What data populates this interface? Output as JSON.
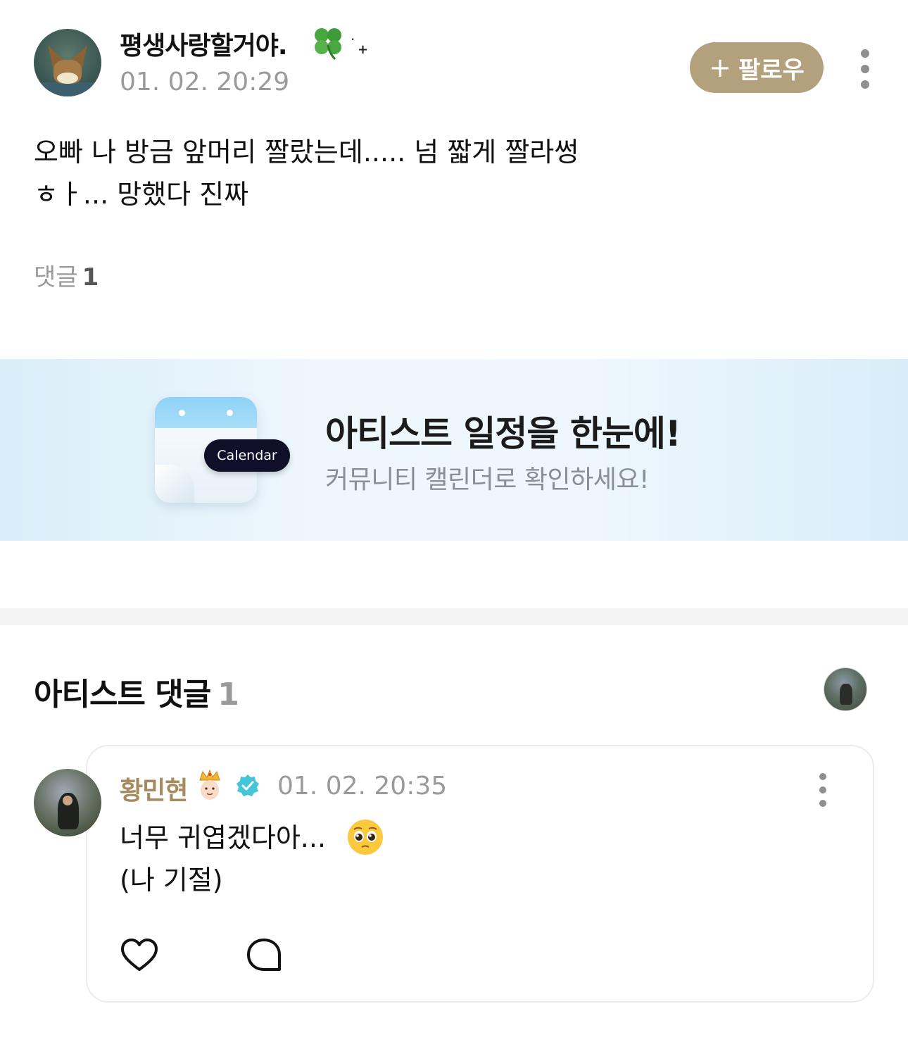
{
  "post": {
    "author_name": "평생사랑할거야.",
    "author_emoji": "four-leaf-clover-icon",
    "timestamp": "01. 02. 20:29",
    "follow_button": {
      "plus": "+",
      "label": "팔로우"
    },
    "body": "오빠 나 방금 앞머리 짤랐는데..... 넘 짧게 짤라썽\nㅎㅏ... 망했다 진짜",
    "comment_label": "댓글",
    "comment_count": "1"
  },
  "banner": {
    "tag": "Calendar",
    "title": "아티스트 일정을 한눈에!",
    "subtitle": "커뮤니티 캘린더로 확인하세요!"
  },
  "artist_comments": {
    "title": "아티스트 댓글",
    "count": "1",
    "items": [
      {
        "name": "황민현",
        "timestamp": "01. 02. 20:35",
        "body": "너무 귀엽겠다아...\n(나 기절)",
        "badges": [
          "crown-prince-emoji",
          "verified-badge-icon"
        ],
        "trailing_emoji": "pleading-face-emoji"
      }
    ]
  },
  "colors": {
    "follow_button_bg": "#b3a07c",
    "artist_name": "#a58a5e",
    "verified_badge": "#45c5d8",
    "muted_text": "#9a9a9a"
  }
}
